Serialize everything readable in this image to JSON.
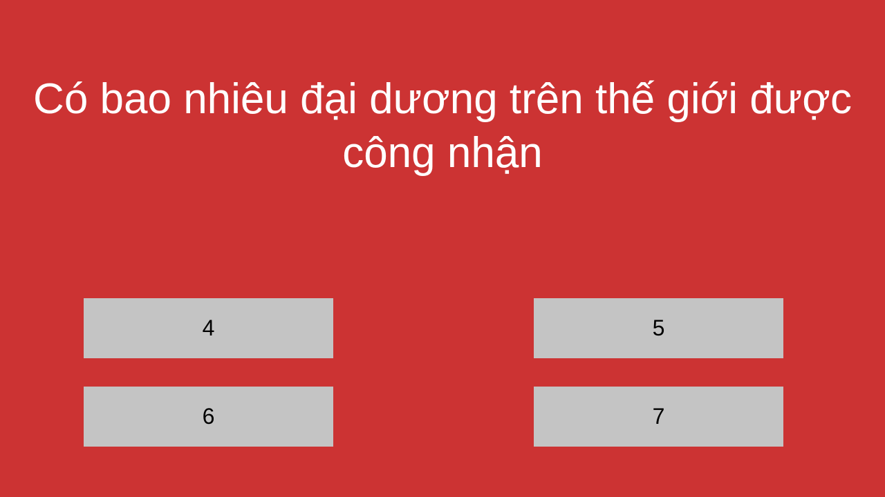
{
  "quiz": {
    "question": "Có bao nhiêu đại dương trên thế giới được công nhận",
    "answers": [
      "4",
      "5",
      "6",
      "7"
    ],
    "colors": {
      "background": "#cc3333",
      "answer_background": "#c4c4c4",
      "question_text": "#ffffff",
      "answer_text": "#000000"
    }
  }
}
